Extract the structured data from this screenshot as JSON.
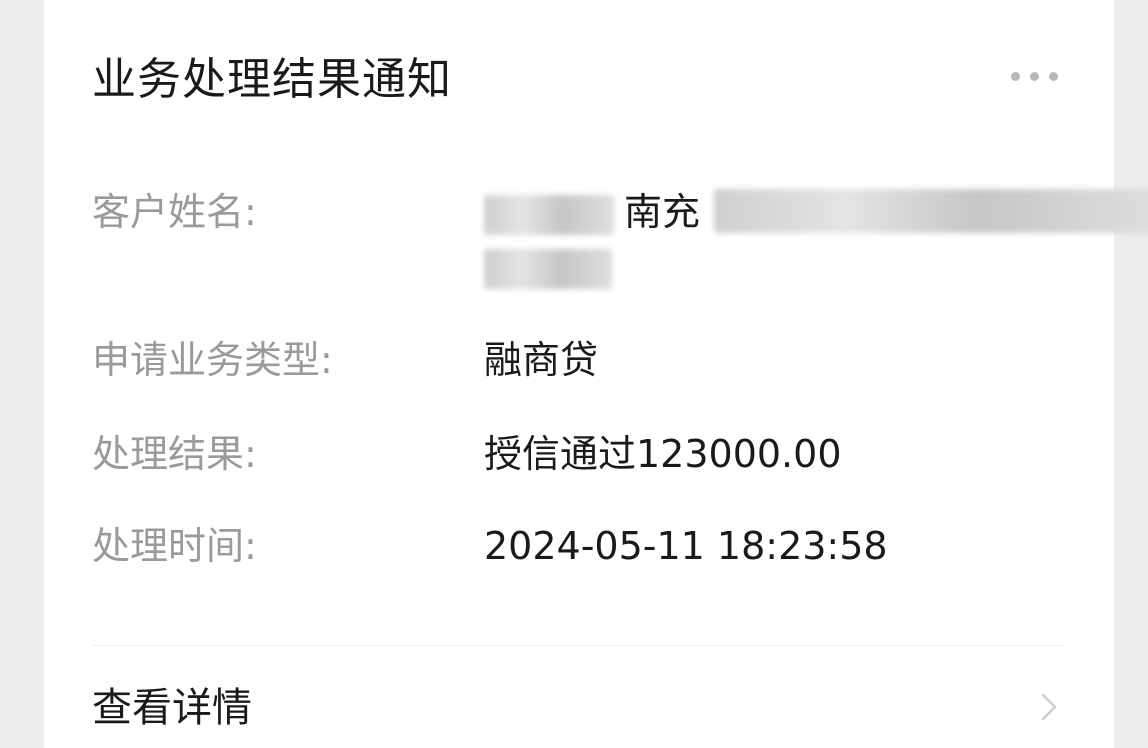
{
  "card": {
    "title": "业务处理结果通知",
    "more_icon": "more-dots-icon"
  },
  "fields": {
    "customer_name": {
      "label": "客户姓名:",
      "visible_text": "南充"
    },
    "business_type": {
      "label": "申请业务类型:",
      "value": "融商贷"
    },
    "result": {
      "label": "处理结果:",
      "value": "授信通过123000.00"
    },
    "time": {
      "label": "处理时间:",
      "value": "2024-05-11 18:23:58"
    }
  },
  "footer": {
    "detail_label": "查看详情",
    "chevron_icon": "chevron-right-icon"
  },
  "colors": {
    "background": "#ededed",
    "card": "#ffffff",
    "label": "#9a9a9a",
    "value": "#1a1a1a"
  }
}
